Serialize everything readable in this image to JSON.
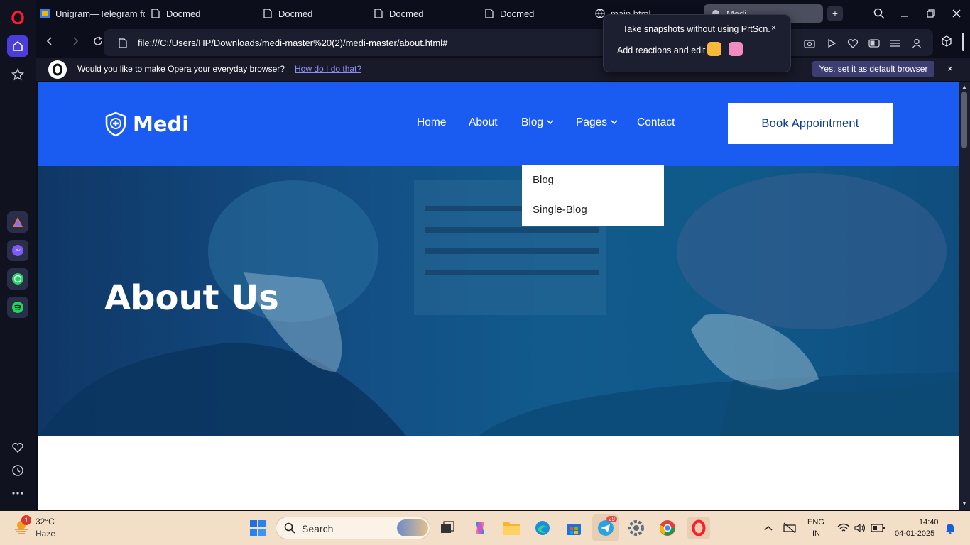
{
  "browser": {
    "tabs": [
      {
        "label": "Unigram—Telegram for"
      },
      {
        "label": "Docmed"
      },
      {
        "label": "Docmed"
      },
      {
        "label": "Docmed"
      },
      {
        "label": "Docmed"
      },
      {
        "label": "main.html"
      },
      {
        "label": "Medi"
      }
    ],
    "url": "file:///C:/Users/HP/Downloads/medi-master%20(2)/medi-master/about.html#",
    "infobar": {
      "question": "Would you like to make Opera your everyday browser?",
      "link": "How do I do that?",
      "button": "Yes, set it as default browser",
      "close": "×"
    },
    "popup": {
      "line1": "Take snapshots without using PrtScn.",
      "line2": "Add reactions and edit",
      "close": "×"
    }
  },
  "site": {
    "logo": "Medi",
    "nav": {
      "home": "Home",
      "about": "About",
      "blog": "Blog",
      "pages": "Pages",
      "contact": "Contact"
    },
    "book_button": "Book Appointment",
    "dropdown": [
      "Blog",
      "Single-Blog"
    ],
    "hero_title": "About Us"
  },
  "taskbar": {
    "weather_temp": "32°C",
    "weather_desc": "Haze",
    "weather_badge": "1",
    "search_placeholder": "Search",
    "telegram_badge": "29",
    "lang1": "ENG",
    "lang2": "IN",
    "time": "14:40",
    "date": "04-01-2025"
  },
  "colors": {
    "brand_blue": "#1a5cf2",
    "opera_red": "#ff1b2d",
    "sidebar_active": "#4a3ddb"
  }
}
